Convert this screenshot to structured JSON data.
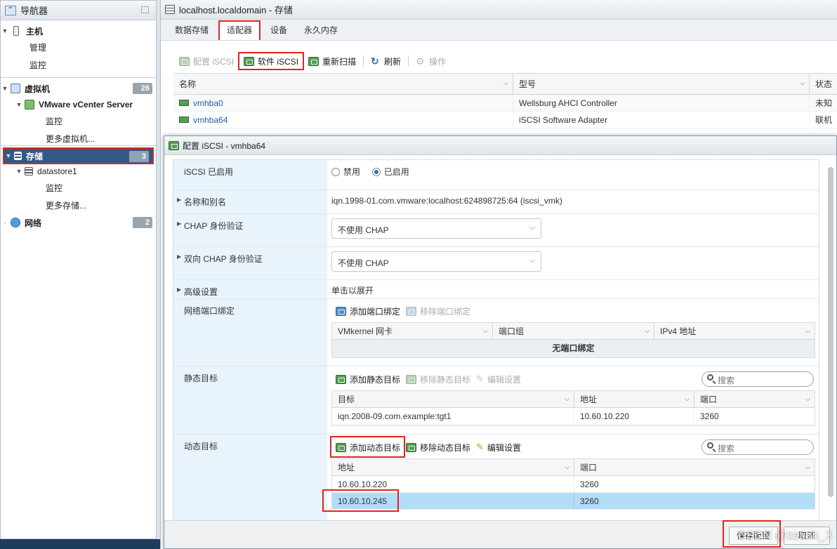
{
  "navigator": {
    "title": "导航器",
    "items": {
      "host": "主机",
      "manage": "管理",
      "monitor": "监控",
      "vms": "虚拟机",
      "vms_count": "26",
      "vcenter": "VMware vCenter Server",
      "vc_monitor": "监控",
      "more_vms": "更多虚拟机...",
      "storage": "存储",
      "storage_count": "3",
      "datastore": "datastore1",
      "ds_monitor": "监控",
      "more_storage": "更多存储...",
      "network": "网络",
      "network_count": "2"
    }
  },
  "main": {
    "title": "localhost.localdomain - 存储",
    "tabs": [
      "数据存储",
      "适配器",
      "设备",
      "永久内存"
    ],
    "toolbar": {
      "config_iscsi": "配置 iSCSI",
      "software_iscsi": "软件 iSCSI",
      "rescan": "重新扫描",
      "refresh": "刷新",
      "actions": "操作"
    },
    "grid": {
      "columns": [
        "名称",
        "型号",
        "状态"
      ],
      "rows": [
        {
          "name": "vmhba0",
          "model": "Wellsburg AHCI Controller",
          "status": "未知"
        },
        {
          "name": "vmhba64",
          "model": "iSCSI Software Adapter",
          "status": "联机"
        }
      ]
    }
  },
  "dialog": {
    "title": "配置 iSCSI - vmhba64",
    "enabled_label": "iSCSI 已启用",
    "disable_option": "禁用",
    "enable_option": "已启用",
    "name_alias_label": "名称和别名",
    "name_alias_value": "iqn.1998-01.com.vmware:localhost:624898725:64 (iscsi_vmk)",
    "chap_label": "CHAP 身份验证",
    "chap_value": "不使用 CHAP",
    "mutual_chap_label": "双向 CHAP 身份验证",
    "mutual_chap_value": "不使用 CHAP",
    "advanced_label": "高级设置",
    "advanced_value": "单击以展开",
    "port_binding_label": "网络端口绑定",
    "add_port_binding": "添加端口绑定",
    "remove_port_binding": "移除端口绑定",
    "port_columns": [
      "VMkernel 网卡",
      "端口组",
      "IPv4 地址"
    ],
    "no_port_binding": "无端口绑定",
    "static_label": "静态目标",
    "add_static": "添加静态目标",
    "remove_static": "移除静态目标",
    "edit_settings": "编辑设置",
    "search_placeholder": "搜索",
    "static_columns": [
      "目标",
      "地址",
      "端口"
    ],
    "static_rows": [
      {
        "target": "iqn.2008-09.com.example:tgt1",
        "address": "10.60.10.220",
        "port": "3260"
      }
    ],
    "dynamic_label": "动态目标",
    "add_dynamic": "添加动态目标",
    "remove_dynamic": "移除动态目标",
    "dynamic_columns": [
      "地址",
      "端口"
    ],
    "dynamic_rows": [
      {
        "address": "10.60.10.220",
        "port": "3260"
      },
      {
        "address": "10.60.10.245",
        "port": "3260"
      }
    ],
    "save_button": "保存配置",
    "cancel_button": "取消"
  },
  "watermark": "CSDN @zetion_3",
  "colors": {
    "highlight_red": "#e0251b",
    "nav_selected": "#2f5a86",
    "selected_row": "#b3dcf7"
  }
}
